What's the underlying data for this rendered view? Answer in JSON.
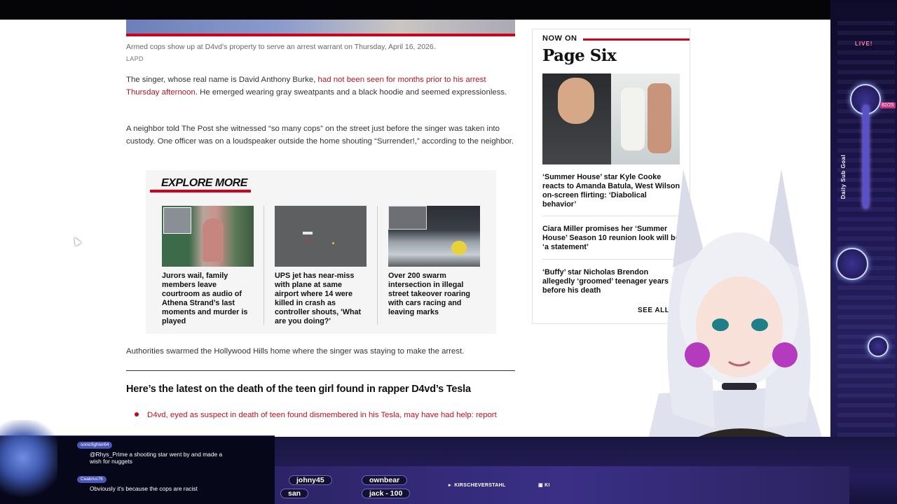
{
  "article": {
    "caption": "Armed cops show up at D4vd's property to serve an arrest warrant on Thursday, April 16, 2026.",
    "credit": "LAPD",
    "p1_text": "The singer, whose real name is David Anthony Burke, ",
    "p1_link": "had not been seen for months prior to his arrest Thursday afternoon",
    "p1_rest": ". He emerged wearing gray sweatpants and a black hoodie and seemed expressionless.",
    "p2": "A neighbor told The Post she witnessed “so many cops” on the street just before the singer was taken into custody. One officer was on a loudspeaker outside the home shouting “Surrender!,” according to the neighbor.",
    "p3": "Authorities swarmed the Hollywood Hills home where the singer was staying to make the arrest.",
    "section_head": "Here’s the latest on the death of the teen girl found in rapper D4vd’s Tesla",
    "bullet": "D4vd, eyed as suspect in death of teen found dismembered in his Tesla, may have had help: report"
  },
  "explore": {
    "title": "EXPLORE MORE",
    "cards": [
      {
        "headline": "Jurors wail, family members leave courtroom as audio of Athena Strand’s last moments and murder is played"
      },
      {
        "headline": "UPS jet has near-miss with plane at same airport where 14 were killed in crash as controller shouts, 'What are you doing?'"
      },
      {
        "headline": "Over 200 swarm intersection in illegal street takeover roaring with cars racing and leaving marks"
      }
    ]
  },
  "page_six": {
    "label": "NOW ON",
    "brand": "Page Six",
    "items": [
      "‘Summer House’ star Kyle Cooke reacts to Amanda Batula, West Wilson on-screen flirting: ‘Diabolical behavior’",
      "Ciara Miller promises her ‘Summer House’ Season 10 reunion look will be ‘a statement’",
      "‘Buffy’ star Nicholas Brendon allegedly ‘groomed’ teenager years before his death"
    ],
    "see_all": "SEE ALL"
  },
  "overlay": {
    "live": "LIVE!",
    "goal_label": "Daily Sub Goal",
    "goal_count": "82/25",
    "subs": [
      "johny45",
      "ownbear",
      "san",
      "jack - 100"
    ],
    "social_1": "KIRSCHEVERSTAHL",
    "social_2": "KI"
  },
  "chat": {
    "messages": [
      {
        "user": "sonicfighter64",
        "text": "@Rhys_Prime a shooting star went by and made a wish for nuggets"
      },
      {
        "user": "Ceabrus76",
        "text": "Obviously it's because the cops are racist"
      }
    ]
  },
  "colors": {
    "accent_red": "#d0021b",
    "link_red": "#b8131f",
    "overlay_purple": "#241d5a"
  }
}
